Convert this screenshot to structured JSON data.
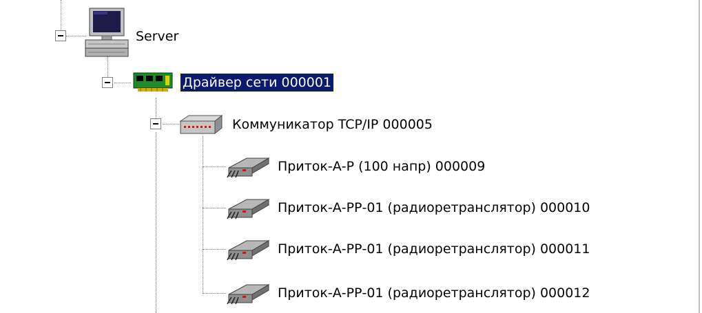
{
  "tree": {
    "selection_colors": {
      "background": "#0a1a6e",
      "text": "#ffffff"
    },
    "server": {
      "label": "Server",
      "icon": "computer-icon",
      "expanded": true
    },
    "network_driver": {
      "label": "Драйвер сети 000001",
      "icon": "network-card-icon",
      "expanded": true,
      "selected": true
    },
    "communicator": {
      "label": "Коммуникатор TCP/IP 000005",
      "icon": "network-hub-icon",
      "expanded": true
    },
    "devices": [
      {
        "label": "Приток-А-Р (100 напр) 000009",
        "icon": "transmitter-device-icon"
      },
      {
        "label": "Приток-А-РР-01 (радиоретранслятор) 000010",
        "icon": "transmitter-device-icon"
      },
      {
        "label": "Приток-А-РР-01 (радиоретранслятор) 000011",
        "icon": "transmitter-device-icon"
      },
      {
        "label": "Приток-А-РР-01 (радиоретранслятор) 000012",
        "icon": "transmitter-device-icon"
      }
    ]
  }
}
